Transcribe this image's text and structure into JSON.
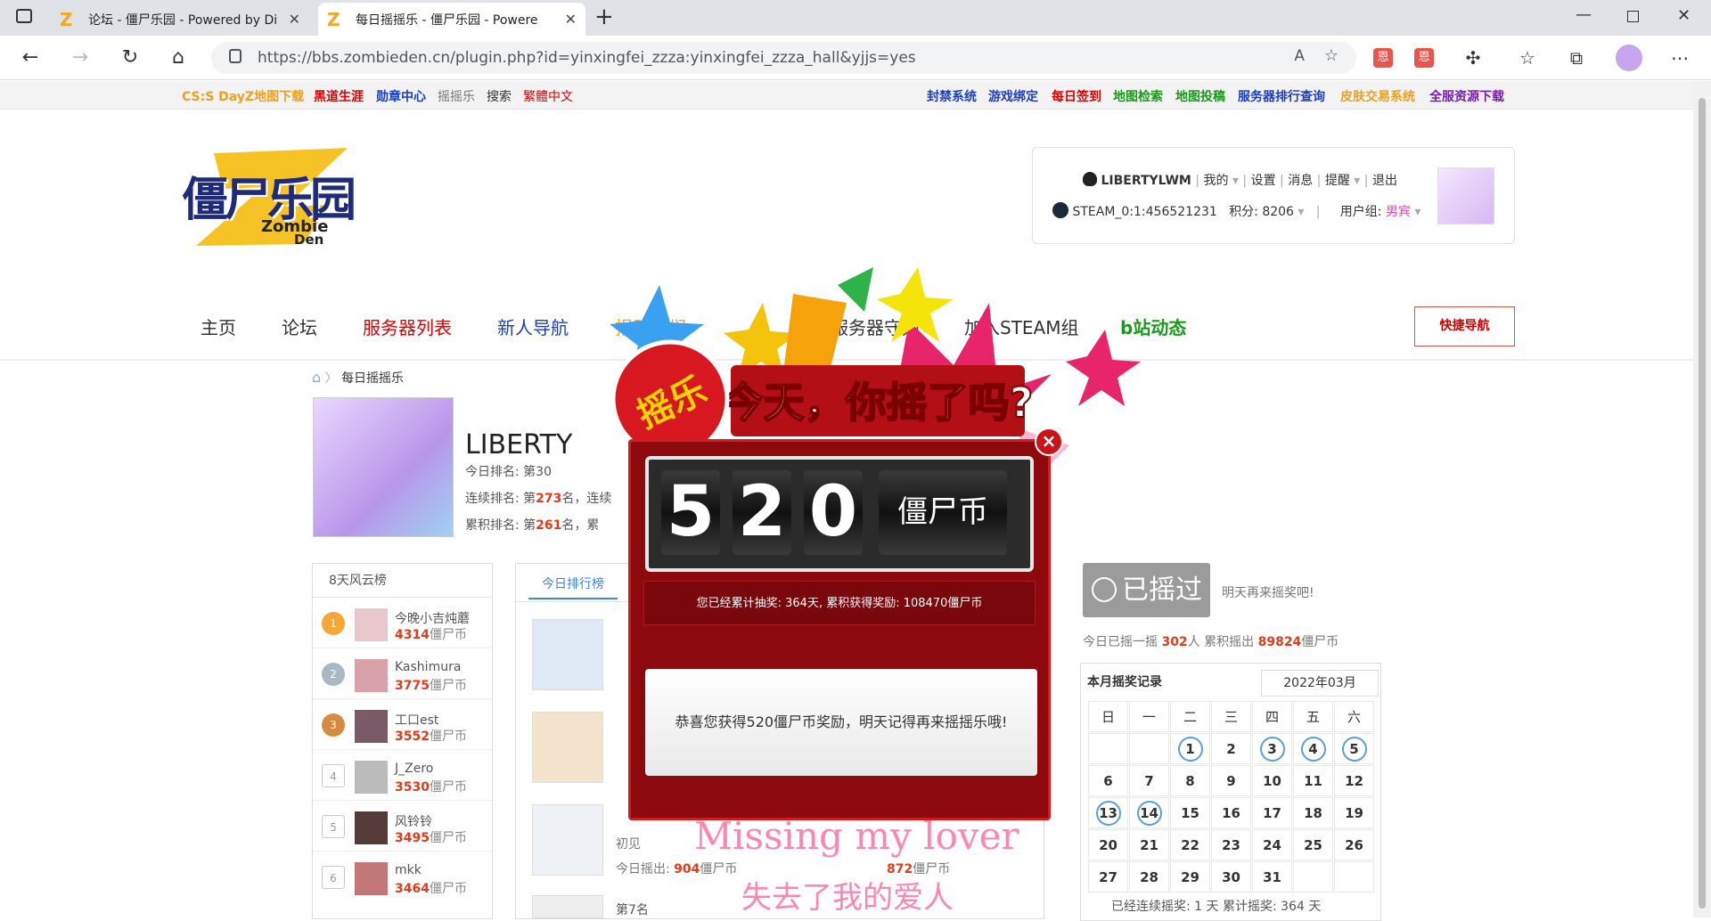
{
  "browser": {
    "tabs": [
      {
        "title": "论坛 - 僵尸乐园 - Powered by Di"
      },
      {
        "title": "每日摇摇乐 - 僵尸乐园 - Powere"
      }
    ],
    "url": "https://bbs.zombieden.cn/plugin.php?id=yinxingfei_zzza:yinxingfei_zzza_hall&yjjs=yes"
  },
  "toplinks_left": [
    "CS:S DayZ地图下载",
    "黑道生涯",
    "勋章中心",
    "摇摇乐",
    "搜索",
    "繁體中文"
  ],
  "toplinks_right": [
    "封禁系统",
    "游戏绑定",
    "每日签到",
    "地图检索",
    "地图投稿",
    "服务器排行查询",
    "皮肤交易系统",
    "全服资源下载"
  ],
  "logo": {
    "cn": "僵尸乐园",
    "en1": "Zombie",
    "en2": "Den"
  },
  "user": {
    "name": "LIBERTYLWM",
    "menu": [
      "我的",
      "设置",
      "消息",
      "提醒",
      "退出"
    ],
    "steam": "STEAM_0:1:456521231",
    "points": "积分: 8206",
    "group_label": "用户组:",
    "group": "男宾"
  },
  "mainnav": [
    "主页",
    "论坛",
    "服务器列表",
    "新人导航",
    "捐助我们",
    "服务器守则",
    "加入STEAM组",
    "b站动态"
  ],
  "quick_nav": "快捷导航",
  "breadcrumb": "每日摇摇乐",
  "profile": {
    "name": "LIBERTY",
    "rank_today": "今日排名: 第30",
    "rank_streak_prefix": "连续排名: 第",
    "rank_streak": "273",
    "rank_streak_suffix": "名，连续",
    "rank_total_prefix": "累积排名: 第",
    "rank_total": "261",
    "rank_total_suffix": "名，累"
  },
  "leftlist": {
    "header": "8天风云榜",
    "items": [
      {
        "rank": "1",
        "name": "今晚小吉炖蘑",
        "value": "4314",
        "unit": "僵尸币"
      },
      {
        "rank": "2",
        "name": "Kashimura",
        "value": "3775",
        "unit": "僵尸币"
      },
      {
        "rank": "3",
        "name": "工口est",
        "value": "3552",
        "unit": "僵尸币"
      },
      {
        "rank": "4",
        "name": "J_Zero",
        "value": "3530",
        "unit": "僵尸币"
      },
      {
        "rank": "5",
        "name": "风铃铃",
        "value": "3495",
        "unit": "僵尸币"
      },
      {
        "rank": "6",
        "name": "mkk",
        "value": "3464",
        "unit": "僵尸币"
      }
    ]
  },
  "midpanel": {
    "tab": "今日排行榜",
    "card3_name": "初见",
    "card3_out": "今日摇出: ",
    "card3_value": "904",
    "card3_unit": "僵尸币",
    "card4_value": "872",
    "card4_unit": "僵尸币",
    "card5_rank": "第7名"
  },
  "shook": {
    "button": "已摇过",
    "note": "明天再来摇奖吧!",
    "today_prefix": "今日已摇一摇 ",
    "today_people": "302",
    "today_mid": "人 累积摇出 ",
    "today_total": "89824",
    "today_unit": "僵尸币"
  },
  "calendar": {
    "title": "本月摇奖记录",
    "month": "2022年03月",
    "weekdays": [
      "日",
      "一",
      "二",
      "三",
      "四",
      "五",
      "六"
    ],
    "days": [
      "",
      "",
      "1",
      "2",
      "3",
      "4",
      "5",
      "6",
      "7",
      "8",
      "9",
      "10",
      "11",
      "12",
      "13",
      "14",
      "15",
      "16",
      "17",
      "18",
      "19",
      "20",
      "21",
      "22",
      "23",
      "24",
      "25",
      "26",
      "27",
      "28",
      "29",
      "30",
      "31",
      "",
      ""
    ],
    "circled": [
      "1",
      "3",
      "4",
      "5",
      "13",
      "14"
    ],
    "footer": "已经连续摇奖: 1 天 累计摇奖: 364 天"
  },
  "popup": {
    "banner": "今天，你摇了吗?",
    "badge": "摇乐",
    "digits": [
      "5",
      "2",
      "0"
    ],
    "coin_label": "僵尸币",
    "cumulative": "您已经累计抽奖: 364天, 累积获得奖励: 108470僵尸币",
    "message": "恭喜您获得520僵尸币奖励，明天记得再来摇摇乐哦!"
  },
  "overlay": {
    "en": "Missing my lover",
    "cn": "失去了我的爱人"
  }
}
